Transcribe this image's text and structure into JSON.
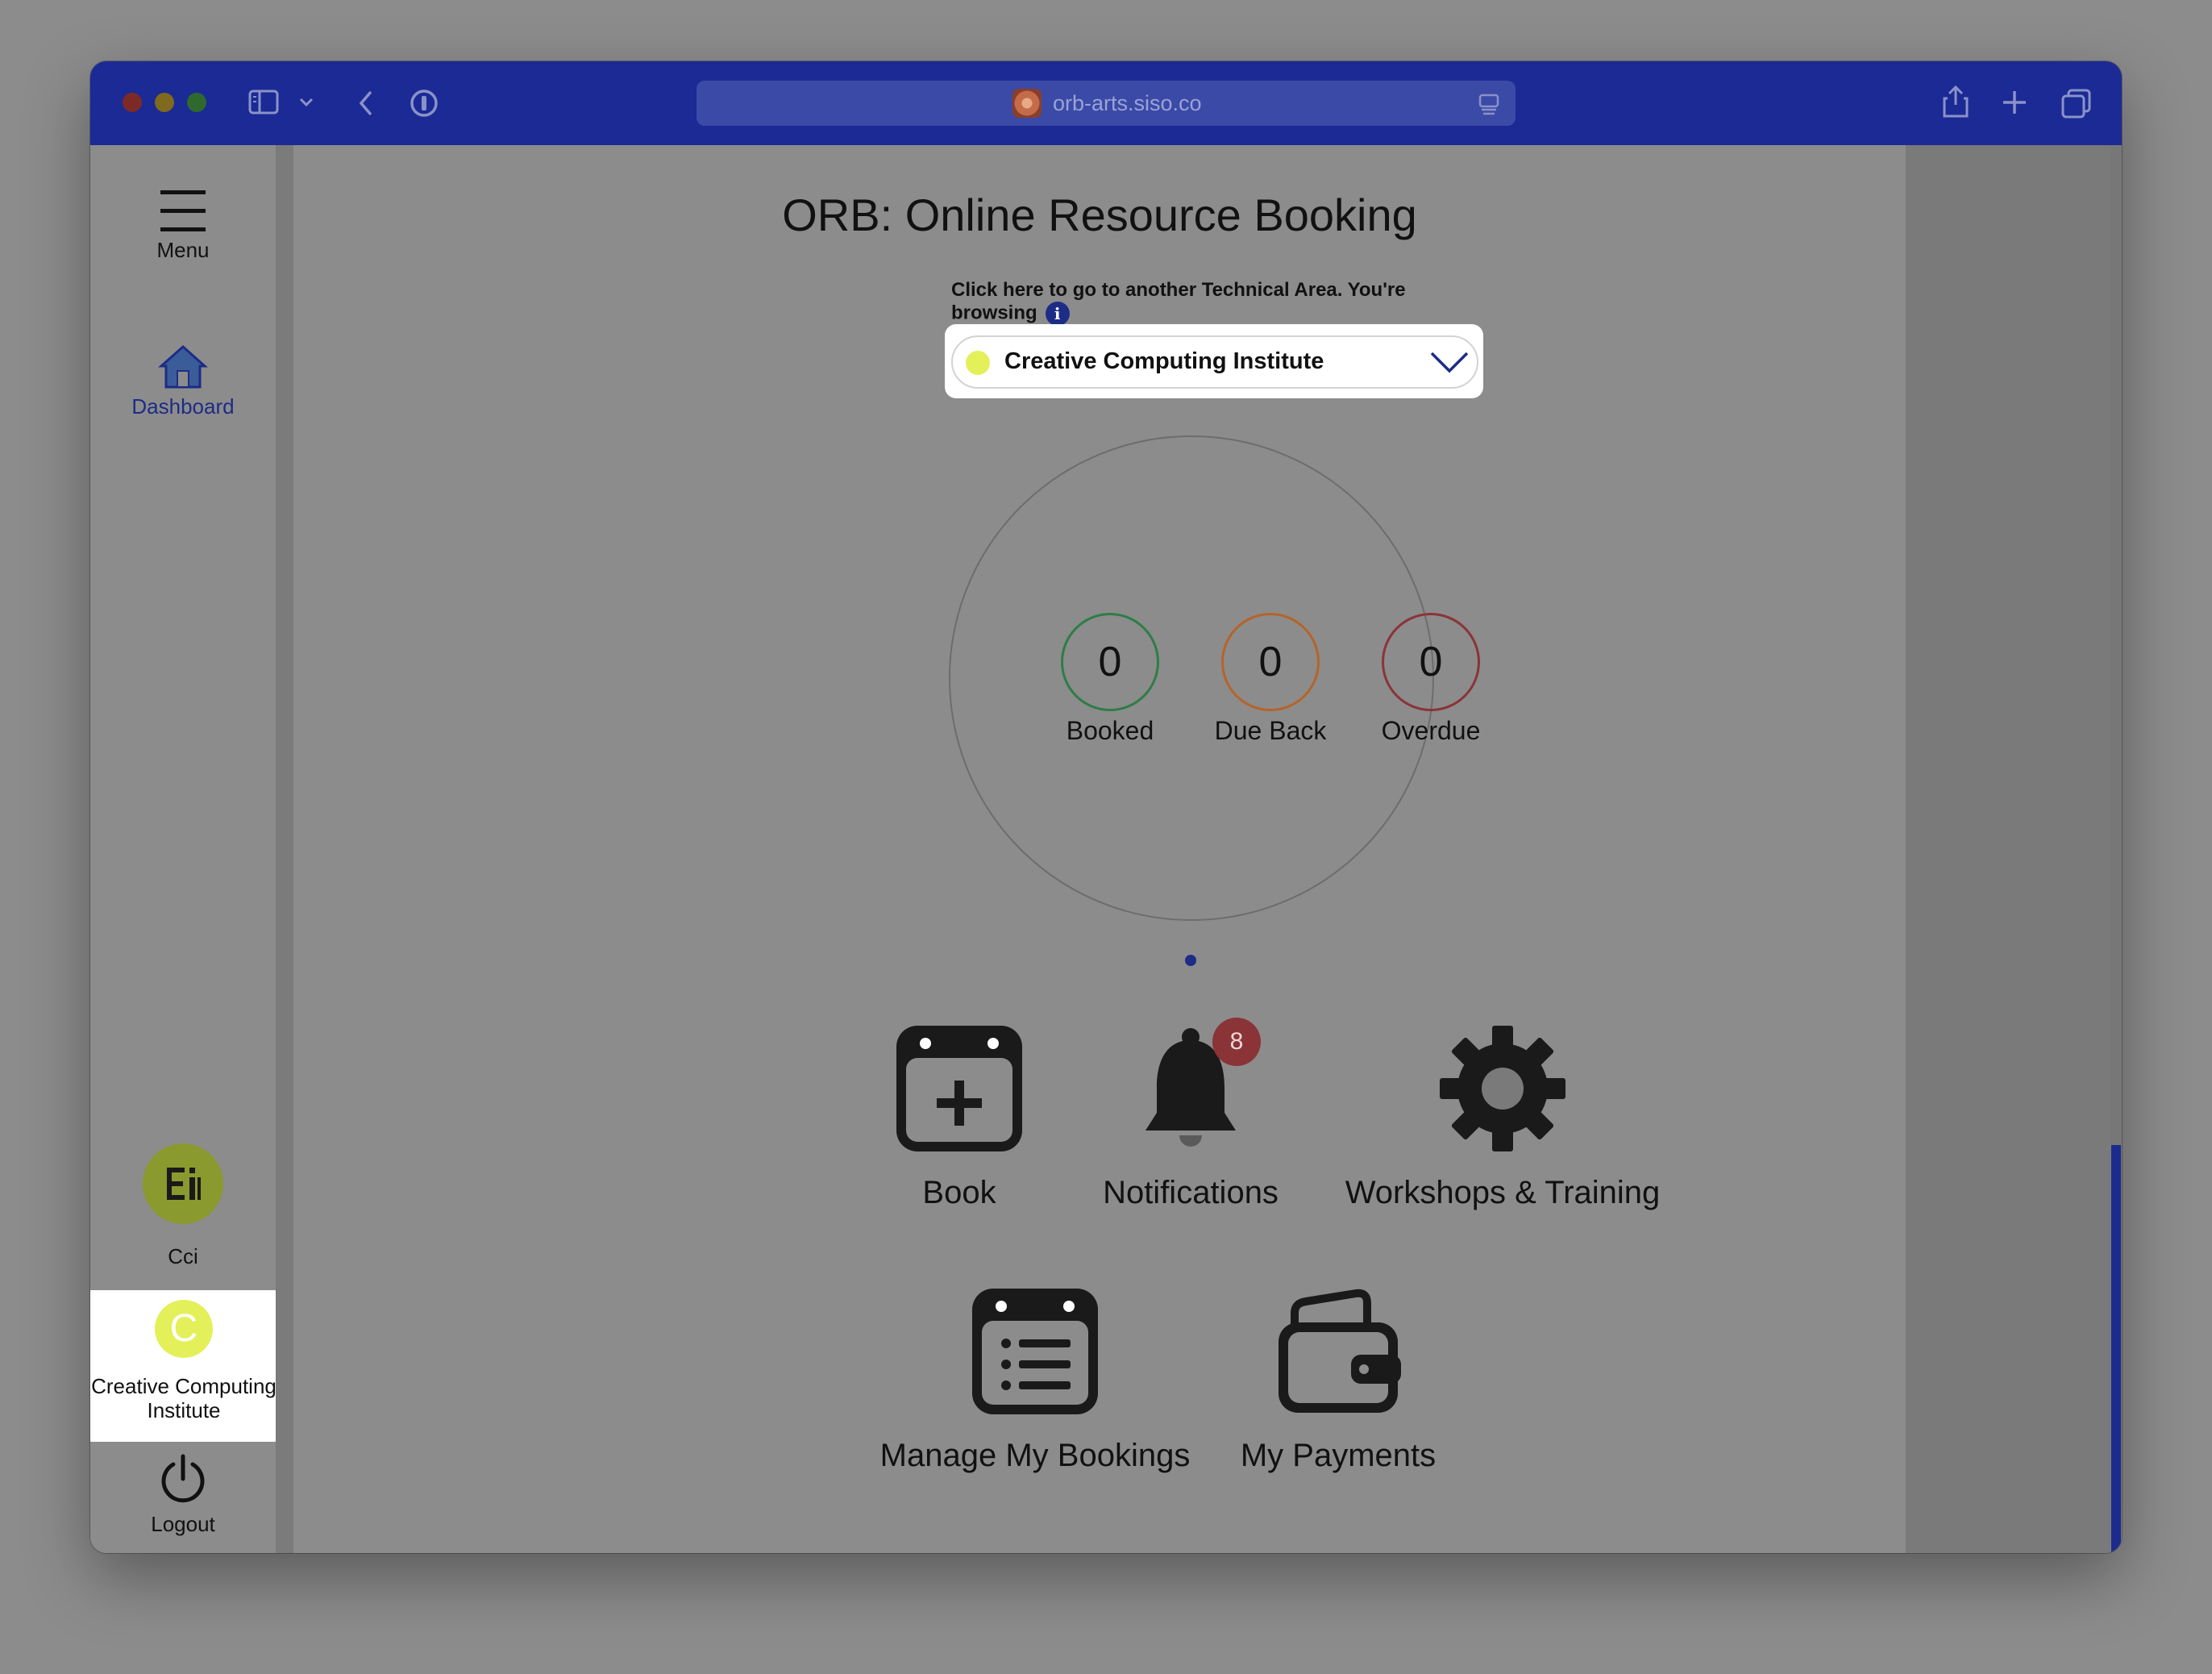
{
  "browser": {
    "url": "orb-arts.siso.co"
  },
  "sidebar": {
    "menu_label": "Menu",
    "dashboard_label": "Dashboard",
    "org_short_label": "Cci",
    "org_card_initial": "C",
    "org_card_label_line1": "Creative Computing",
    "org_card_label_line2": "Institute",
    "logout_label": "Logout"
  },
  "main": {
    "title": "ORB: Online Resource Booking",
    "browse_hint": "Click here to go to another Technical Area. You're browsing",
    "info_icon": "i",
    "area_select_value": "Creative Computing Institute",
    "stats": [
      {
        "value": "0",
        "label": "Booked",
        "color": "#2e7d46"
      },
      {
        "value": "0",
        "label": "Due Back",
        "color": "#b5642a"
      },
      {
        "value": "0",
        "label": "Overdue",
        "color": "#8a3438"
      }
    ],
    "tiles": {
      "book": "Book",
      "notifications": "Notifications",
      "notifications_badge": "8",
      "workshops": "Workshops & Training",
      "manage_bookings": "Manage My Bookings",
      "payments": "My Payments"
    }
  },
  "colors": {
    "titlebar": "#1b2a94",
    "accent": "#1d2c86",
    "org_dot": "#e4f05a",
    "org_logo": "#8a9a2e"
  }
}
